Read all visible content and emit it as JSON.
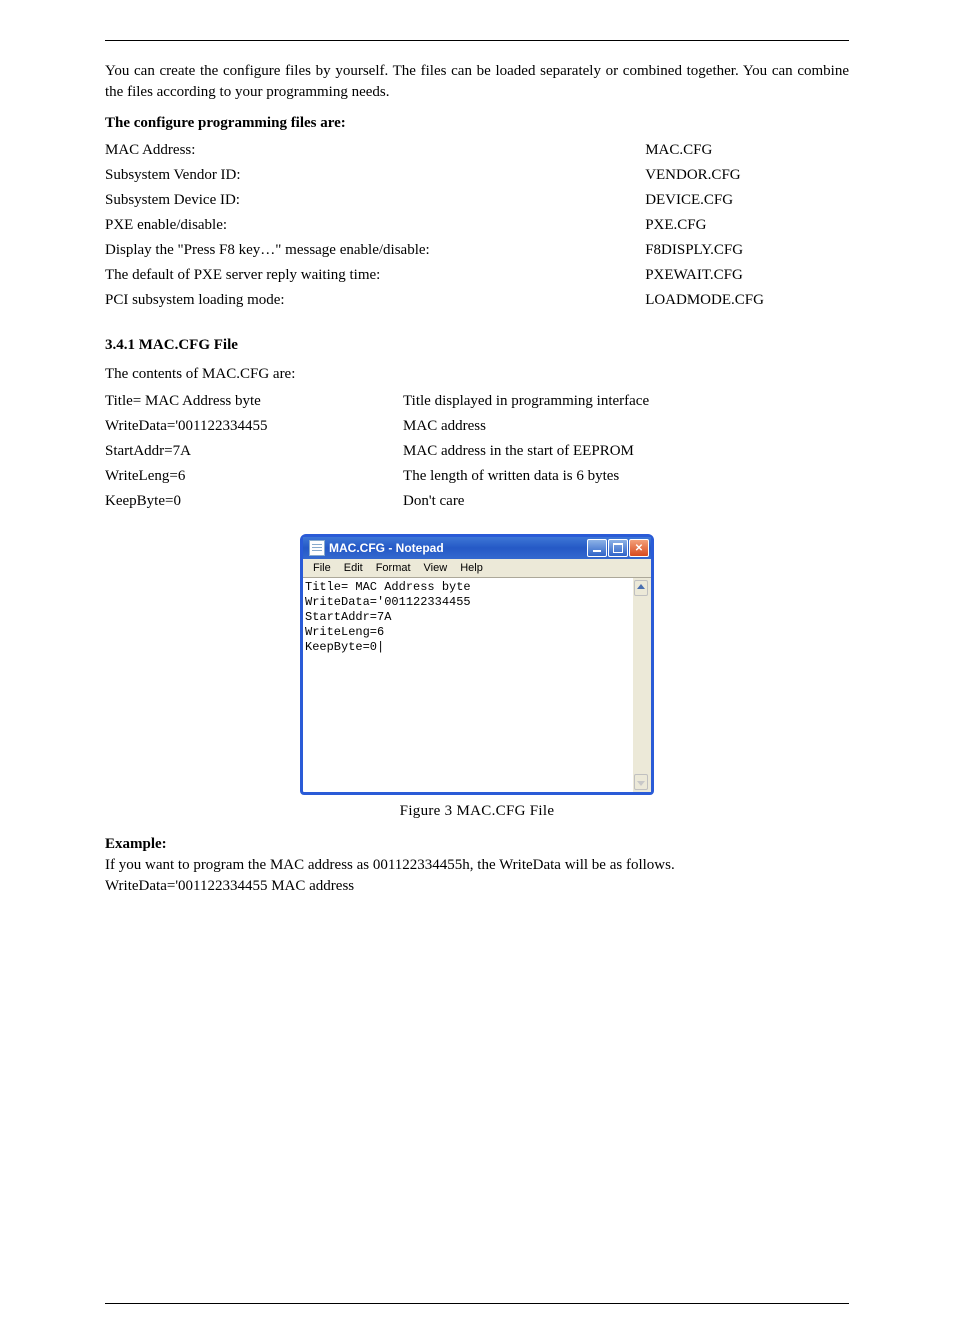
{
  "intro": "You can create the configure files by yourself. The files can be loaded separately or combined together. You can combine the files according to your programming needs.",
  "cfg_label": "The configure programming files are:",
  "cfg": [
    {
      "k": "MAC Address:",
      "v": "MAC.CFG"
    },
    {
      "k": "Subsystem Vendor ID:",
      "v": "VENDOR.CFG"
    },
    {
      "k": "Subsystem Device ID:",
      "v": "DEVICE.CFG"
    },
    {
      "k": "PXE enable/disable:",
      "v": "PXE.CFG"
    },
    {
      "k": "Display the \"Press F8 key…\" message enable/disable:",
      "v": "F8DISPLY.CFG"
    },
    {
      "k": "The default of PXE server reply waiting time:",
      "v": "PXEWAIT.CFG"
    },
    {
      "k": "PCI subsystem loading mode:",
      "v": "LOADMODE.CFG"
    }
  ],
  "heading1": "3.4.1 MAC.CFG File",
  "fields_label": "The contents of MAC.CFG are:",
  "fields": [
    {
      "k": "Title= MAC Address byte",
      "v": "Title displayed in programming interface"
    },
    {
      "k": "WriteData='001122334455",
      "v": "MAC address"
    },
    {
      "k": "StartAddr=7A",
      "v": "MAC address in the start of EEPROM"
    },
    {
      "k": "WriteLeng=6",
      "v": "The length of written data is 6 bytes"
    },
    {
      "k": "KeepByte=0",
      "v": "Don't care"
    }
  ],
  "notepad": {
    "title": "MAC.CFG - Notepad",
    "menus": [
      "File",
      "Edit",
      "Format",
      "View",
      "Help"
    ],
    "lines": "Title= MAC Address byte\nWriteData='001122334455\nStartAddr=7A\nWriteLeng=6\nKeepByte=0|"
  },
  "fig_caption": "Figure 3  MAC.CFG File",
  "example_label": "Example:",
  "example_text": "If you want to program the MAC address as 001122334455h, the WriteData will be as follows.",
  "example_value": "WriteData='001122334455       MAC address"
}
